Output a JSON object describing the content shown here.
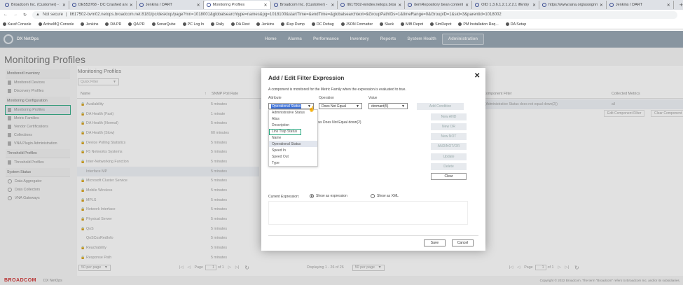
{
  "browser": {
    "tabs": [
      {
        "label": "Broadcom Inc. (Customer) - Sa",
        "active": false
      },
      {
        "label": "DE553768 - DC Crashed and N",
        "active": false
      },
      {
        "label": "Jenkins / DART",
        "active": false
      },
      {
        "label": "Monitoring Profiles",
        "active": true
      },
      {
        "label": "Broadcom Inc. (Customer) - Sa",
        "active": false
      },
      {
        "label": "lt617502-windev.netops.broa",
        "active": false
      },
      {
        "label": "itemRepository bean contents",
        "active": false
      },
      {
        "label": "OID 1.3.6.1.2.1.2.2.1 ifEntry ref",
        "active": false
      },
      {
        "label": "https://www.iana.org/assignm",
        "active": false
      },
      {
        "label": "Jenkins / DART",
        "active": false
      }
    ],
    "security": "Not secure",
    "url": "lt617502-bvm02.netops.broadcom.net:8181/pc/desktop/page?mn=1018001&globalsearchtype=names&pg=1018100&startTime=&endTime=&globalsearchtext=&GroupPathIDs=1&timeRange=0&GroupID=1&sid=3&parentid=1018002",
    "bookmarks": [
      "Karaf Console",
      "ActiveMQ Console",
      "Jenkins",
      "DA PR",
      "QA PR",
      "SonarQube",
      "PC Log In",
      "Rally",
      "DA Rest",
      "Jenkins",
      "iRep Dump",
      "DC Debug",
      "JSON Formatter",
      "Slack",
      "MIB Depot",
      "SimDepot",
      "PM Installation Req...",
      "DA Setup"
    ]
  },
  "app": {
    "name": "DX NetOps",
    "nav": [
      "Home",
      "Alarms",
      "Performance",
      "Inventory",
      "Reports",
      "System Health",
      "Administration"
    ],
    "nav_selected": "Administration",
    "page_title": "Monitoring Profiles"
  },
  "sidebar": {
    "sections": [
      {
        "title": "Monitored Inventory",
        "items": [
          {
            "label": "Monitored Devices"
          },
          {
            "label": "Discovery Profiles"
          }
        ]
      },
      {
        "title": "Monitoring Configuration",
        "items": [
          {
            "label": "Monitoring Profiles",
            "selected": true
          },
          {
            "label": "Metric Families"
          },
          {
            "label": "Vendor Certifications"
          },
          {
            "label": "Collections"
          },
          {
            "label": "VNA Plugin Administration"
          }
        ]
      },
      {
        "title": "Threshold Profiles",
        "items": [
          {
            "label": "Threshold Profiles"
          }
        ]
      },
      {
        "title": "System Status",
        "items": [
          {
            "label": "Data Aggregator"
          },
          {
            "label": "Data Collectors"
          },
          {
            "label": "VNA Gateways"
          }
        ]
      }
    ]
  },
  "main": {
    "title": "Monitoring Profiles",
    "quick_filter_placeholder": "Quick Filter",
    "columns": [
      "Name",
      "SNMP Poll Rate"
    ],
    "rows": [
      {
        "name": "Availability",
        "rate": "5 minutes",
        "locked": true
      },
      {
        "name": "DA Health (Fast)",
        "rate": "1 minute",
        "locked": true
      },
      {
        "name": "DA Health (Normal)",
        "rate": "5 minutes",
        "locked": true
      },
      {
        "name": "DA Health (Slow)",
        "rate": "60 minutes",
        "locked": true
      },
      {
        "name": "Device Polling Statistics",
        "rate": "5 minutes",
        "locked": true
      },
      {
        "name": "F5 Networks Systems",
        "rate": "5 minutes",
        "locked": true
      },
      {
        "name": "Inter-Networking Function",
        "rate": "5 minutes",
        "locked": true
      },
      {
        "name": "Interface MP",
        "rate": "5 minutes",
        "locked": false,
        "selected": true
      },
      {
        "name": "Microsoft Cluster Service",
        "rate": "5 minutes",
        "locked": true
      },
      {
        "name": "Mobile Wireless",
        "rate": "5 minutes",
        "locked": true
      },
      {
        "name": "MPLS",
        "rate": "5 minutes",
        "locked": true
      },
      {
        "name": "Network Interface",
        "rate": "5 minutes",
        "locked": true
      },
      {
        "name": "Physical Server",
        "rate": "5 minutes",
        "locked": true
      },
      {
        "name": "QoS",
        "rate": "5 minutes",
        "locked": true
      },
      {
        "name": "QoSCosRedInfo",
        "rate": "5 minutes",
        "locked": false
      },
      {
        "name": "Reachability",
        "rate": "5 minutes",
        "locked": true
      },
      {
        "name": "Response Path",
        "rate": "5 minutes",
        "locked": true
      }
    ],
    "per_page": "50 per page",
    "page_label": "Page",
    "page": "1",
    "of_pages": "of 1",
    "right": {
      "edit_filter": "Edit Component Filter",
      "clear_filter": "Clear Component",
      "columns": [
        "Component Filter",
        "Collected Metrics"
      ],
      "row": {
        "filter": "(Administrative Status does not equal down(2))",
        "metrics": "all"
      },
      "displaying": "Displaying 1 - 26 of 26",
      "per_page": "50 per page",
      "page": "1",
      "of_pages": "of 1"
    }
  },
  "footer": {
    "brand": "BROADCOM",
    "product": "DX NetOps",
    "copyright": "Copyright © 2022 Broadcom. The term \"Broadcom\" refers to Broadcom Inc. and/or its subsidiaries."
  },
  "modal": {
    "title": "Add / Edit Filter Expression",
    "description": "A component is monitored for the Metric Family when the expression is evaluated to true.",
    "attribute_label": "Attribute",
    "operation_label": "Operation",
    "value_label": "Value",
    "attribute": "Operational Status",
    "operation": "Does Not Equal",
    "value": "dormant(5)",
    "attribute_options": [
      "Administrative Status",
      "Alias",
      "Description",
      "Link Trap Status",
      "Name",
      "Operational Status",
      "Speed In",
      "Speed Out",
      "Type"
    ],
    "highlighted_option": "Link Trap Status",
    "expression_text": "tus Does Not Equal down(2)",
    "buttons": [
      "Add Condition",
      "New AND",
      "New OR",
      "New NOT",
      "AND/NOT/OR",
      "Update",
      "Delete",
      "Clear"
    ],
    "current_expression_label": "Current Expression:",
    "radio_expression": "Show as expression",
    "radio_xml": "Show as XML",
    "save": "Save",
    "cancel": "Cancel"
  }
}
